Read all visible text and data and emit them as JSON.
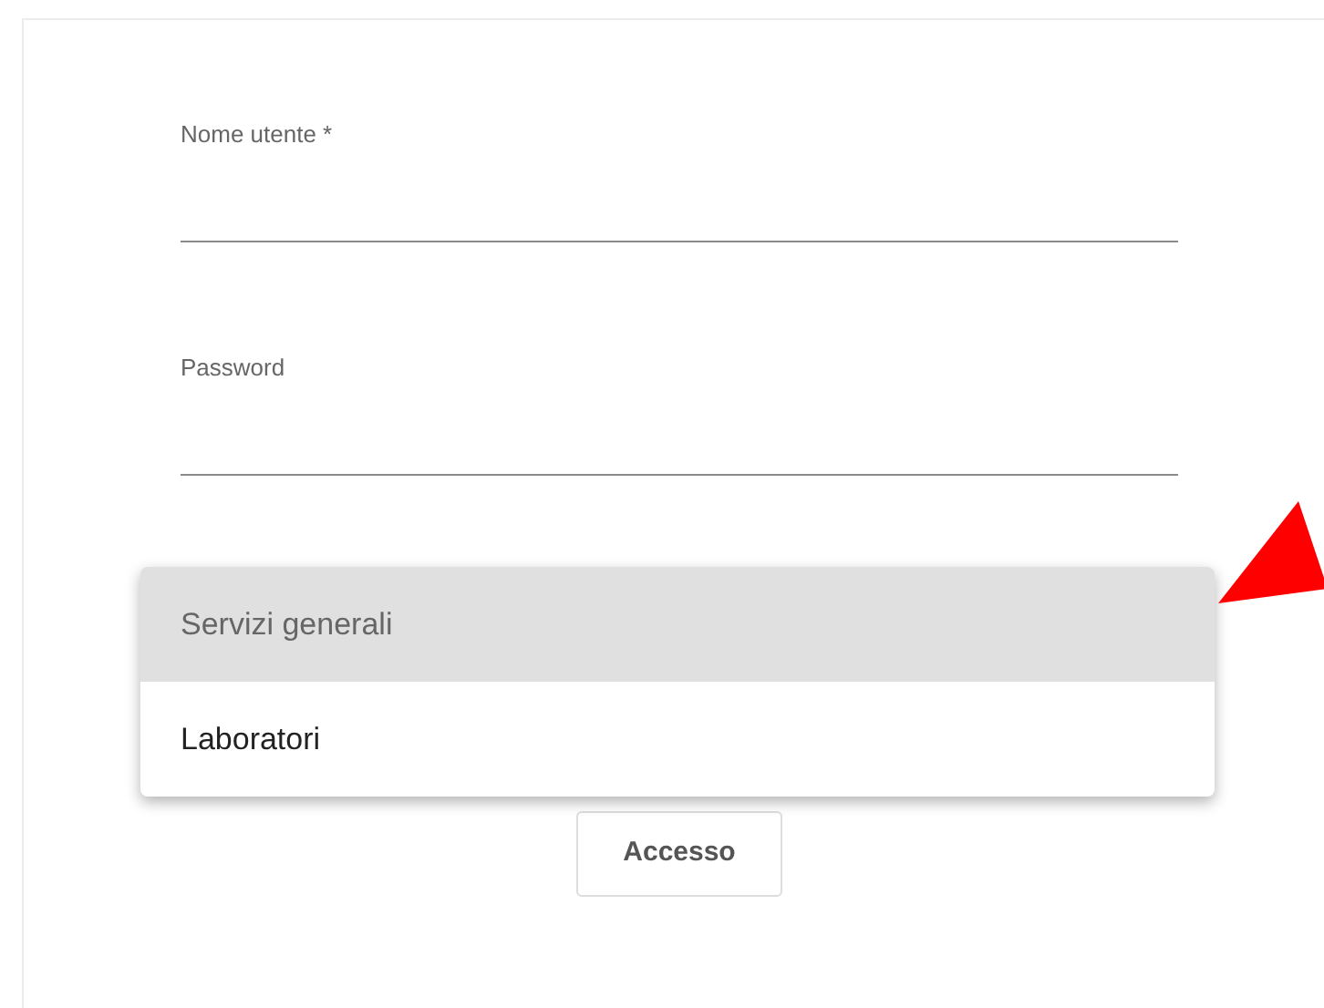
{
  "fields": [
    {
      "label": "Nome utente *"
    },
    {
      "label": "Password"
    }
  ],
  "menu": {
    "options": [
      {
        "label": "Servizi generali",
        "selected": true
      },
      {
        "label": "Laboratori",
        "selected": false
      }
    ]
  },
  "submit_button": "Accesso",
  "annotation": {
    "kind": "arrow"
  }
}
